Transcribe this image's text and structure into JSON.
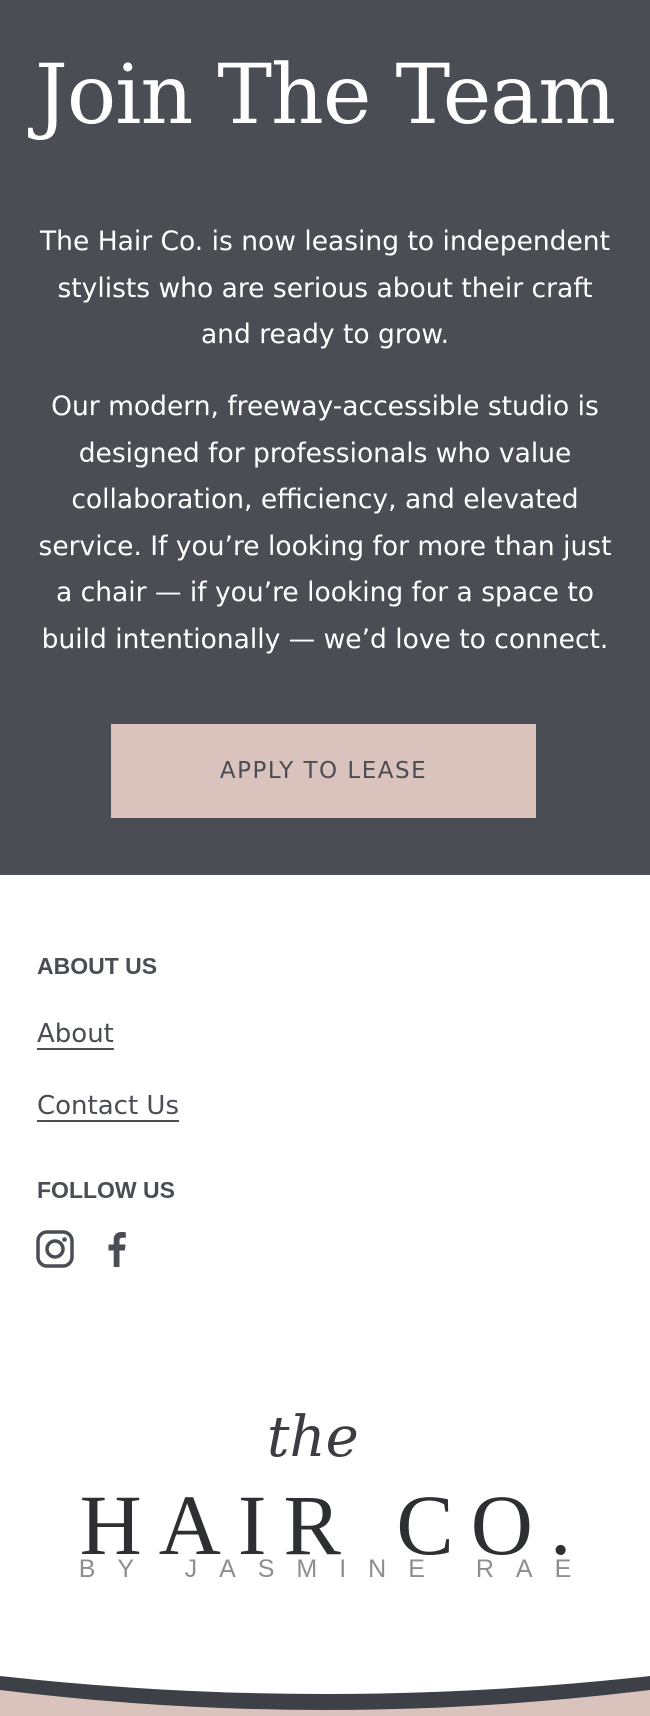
{
  "hero": {
    "title": "Join The Team",
    "paragraph_1": "The Hair Co. is now leasing to independent stylists who are serious about their craft and ready to grow.",
    "paragraph_2": "Our modern, freeway-accessible studio is designed for professionals who value collaboration, efficiency, and elevated service. If you’re looking for more than just a chair — if you’re looking for a space to build intentionally — we’d love to connect.",
    "cta_label": "APPLY TO LEASE"
  },
  "footer": {
    "about_heading": "ABOUT US",
    "links": [
      "About",
      "Contact Us"
    ],
    "follow_heading": "FOLLOW US",
    "social_icons": [
      "instagram-icon",
      "facebook-icon"
    ]
  },
  "logo": {
    "script": "the",
    "main": "HAIR CO.",
    "sub": "BY JASMINE RAE"
  },
  "colors": {
    "hero_bg": "#4a4d54",
    "accent_pink": "#dbc3bd",
    "text_dark": "#4a4d54"
  }
}
